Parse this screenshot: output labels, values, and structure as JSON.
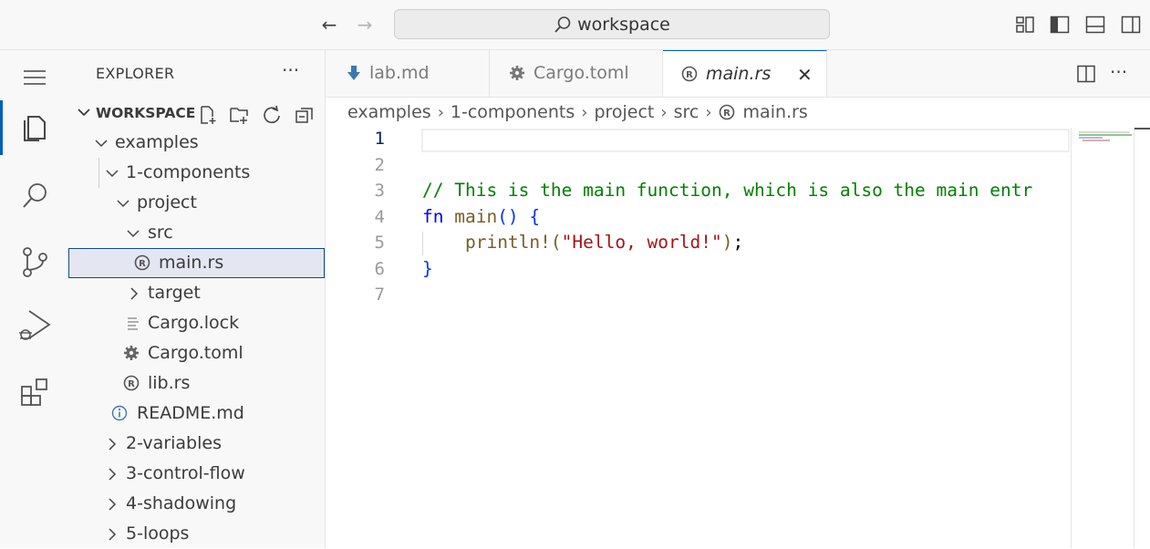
{
  "titlebar": {
    "search_text": "workspace",
    "back": "←",
    "forward": "→"
  },
  "sidebar": {
    "title": "EXPLORER",
    "more": "···",
    "workspace_label": "WORKSPACE",
    "tree": [
      {
        "label": "examples",
        "kind": "folder-open"
      },
      {
        "label": "1-components",
        "kind": "folder-open"
      },
      {
        "label": "project",
        "kind": "folder-open"
      },
      {
        "label": "src",
        "kind": "folder-open"
      },
      {
        "label": "main.rs",
        "kind": "rust-file",
        "selected": true
      },
      {
        "label": "target",
        "kind": "folder-closed"
      },
      {
        "label": "Cargo.lock",
        "kind": "text-file"
      },
      {
        "label": "Cargo.toml",
        "kind": "gear-file"
      },
      {
        "label": "lib.rs",
        "kind": "rust-file"
      },
      {
        "label": "README.md",
        "kind": "info-file"
      },
      {
        "label": "2-variables",
        "kind": "folder-closed"
      },
      {
        "label": "3-control-flow",
        "kind": "folder-closed"
      },
      {
        "label": "4-shadowing",
        "kind": "folder-closed"
      },
      {
        "label": "5-loops",
        "kind": "folder-closed"
      }
    ]
  },
  "tabs": [
    {
      "label": "lab.md",
      "icon": "markdown-download-icon"
    },
    {
      "label": "Cargo.toml",
      "icon": "gear-icon"
    },
    {
      "label": "main.rs",
      "icon": "rust-icon",
      "active": true,
      "close": "✕"
    }
  ],
  "editor_actions": {
    "more": "···"
  },
  "breadcrumb": [
    "examples",
    "1-components",
    "project",
    "src",
    "main.rs"
  ],
  "breadcrumb_sep": "›",
  "code": {
    "line_numbers": [
      "1",
      "2",
      "3",
      "4",
      "5",
      "6",
      "7"
    ],
    "line3": "// This is the main function, which is also the main entr",
    "line4_kw": "fn",
    "line4_name": " main",
    "line4_parens": "()",
    "line4_brace": " {",
    "line5_indent": "    ",
    "line5_fn": "println!",
    "line5_open": "(",
    "line5_str": "\"Hello, world!\"",
    "line5_close": ")",
    "line5_semi": ";",
    "line6": "}"
  },
  "colors": {
    "accent": "#005fb8",
    "comment": "#008000",
    "keyword": "#0000ff",
    "string": "#a31515",
    "macro": "#795e26"
  }
}
